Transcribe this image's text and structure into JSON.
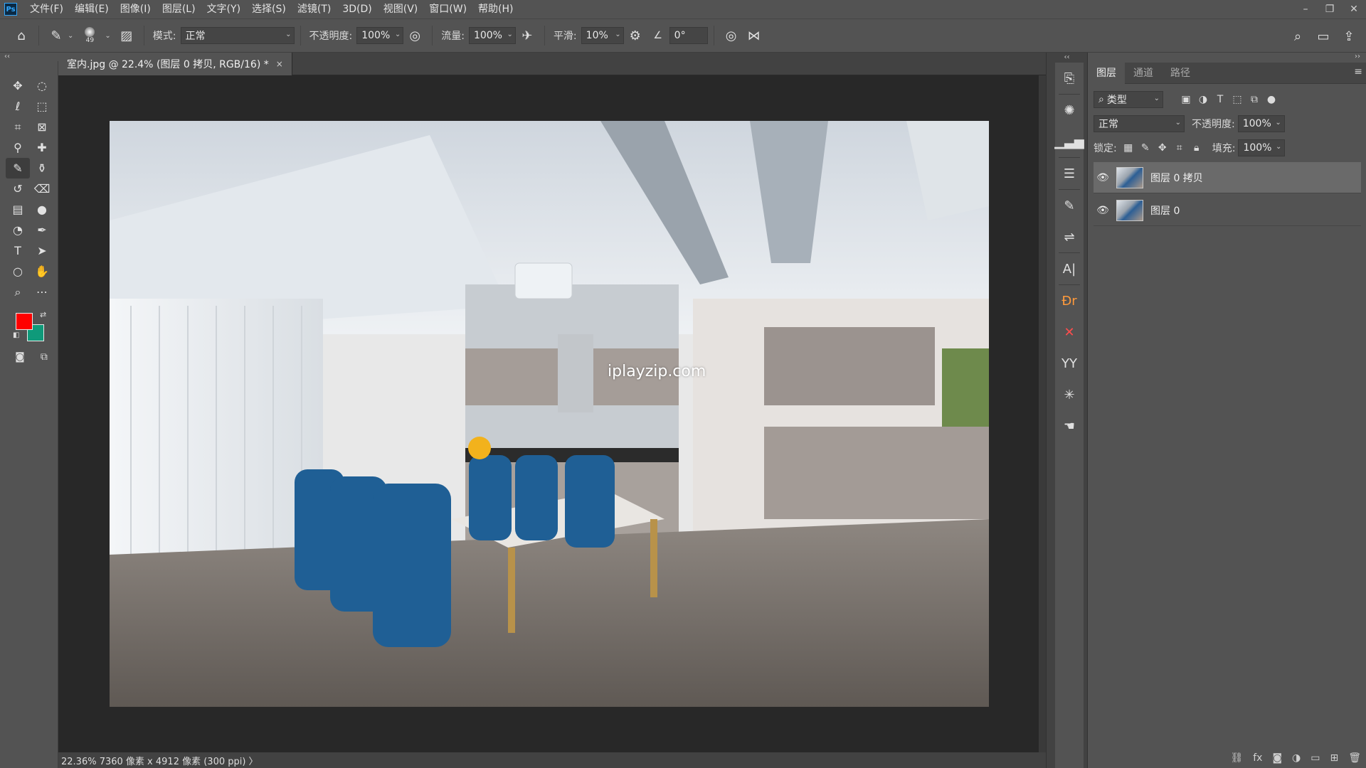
{
  "menu": [
    "文件(F)",
    "编辑(E)",
    "图像(I)",
    "图层(L)",
    "文字(Y)",
    "选择(S)",
    "滤镜(T)",
    "3D(D)",
    "视图(V)",
    "窗口(W)",
    "帮助(H)"
  ],
  "window_controls": {
    "minimize": "–",
    "restore": "❐",
    "close": "✕"
  },
  "options": {
    "brush_size": "49",
    "mode_label": "模式:",
    "mode_value": "正常",
    "opacity_label": "不透明度:",
    "opacity_value": "100%",
    "flow_label": "流量:",
    "flow_value": "100%",
    "smoothing_label": "平滑:",
    "smoothing_value": "10%",
    "angle_value": "0°"
  },
  "document": {
    "tab_title": "室内.jpg @ 22.4% (图层 0 拷贝, RGB/16) *",
    "close": "×",
    "watermark": "iplayzip.com"
  },
  "status": {
    "text": "22.36%  7360 像素 x 4912 像素 (300 ppi)",
    "arrow": "〉"
  },
  "panel": {
    "tabs": [
      "图层",
      "通道",
      "路径"
    ],
    "filter_label": "类型",
    "blend_mode": "正常",
    "opacity_label": "不透明度:",
    "opacity_value": "100%",
    "lock_label": "锁定:",
    "fill_label": "填充:",
    "fill_value": "100%",
    "layers": [
      {
        "name": "图层 0 拷贝",
        "selected": true
      },
      {
        "name": "图层 0",
        "selected": false
      }
    ]
  },
  "colors": {
    "foreground": "#ff0000",
    "background": "#0f9a7a"
  }
}
